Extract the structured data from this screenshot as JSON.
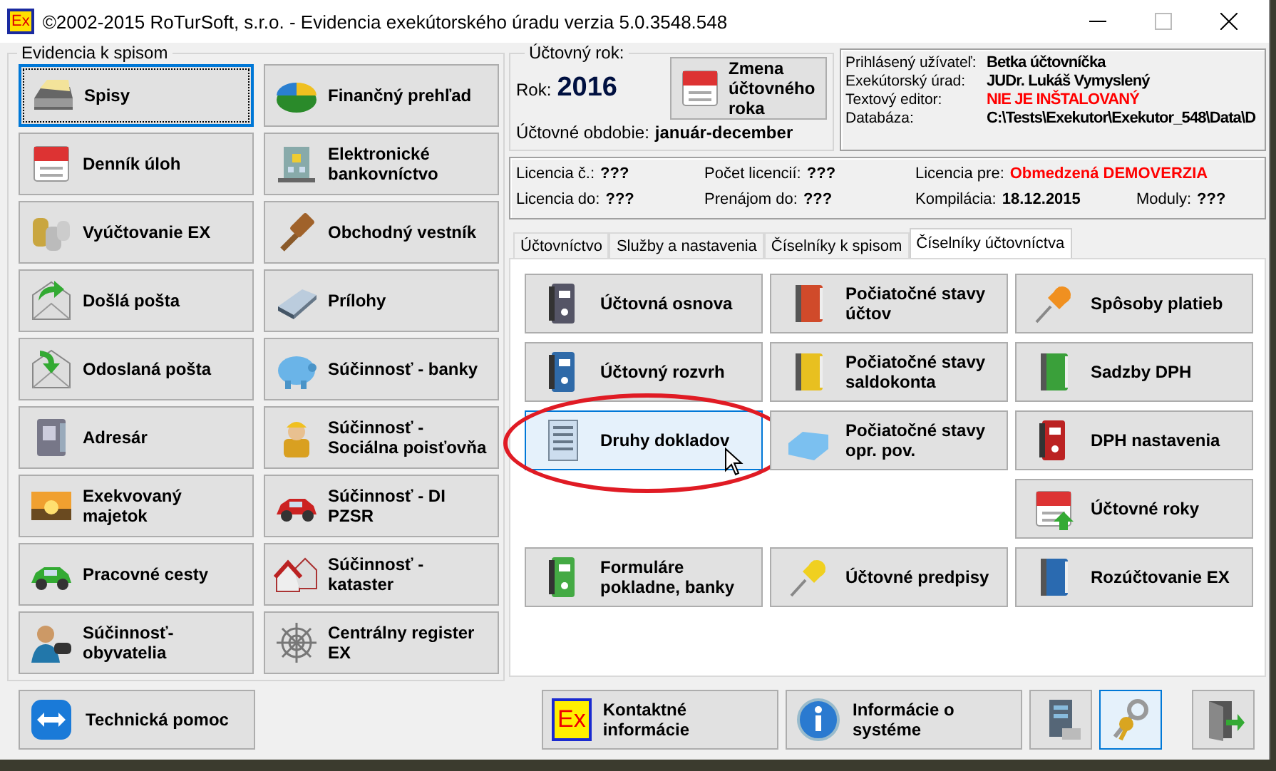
{
  "window": {
    "icon_text": "Ex",
    "title": "©2002-2015 RoTurSoft, s.r.o. - Evidencia exekútorského úradu verzia 5.0.3548.548"
  },
  "records_group": {
    "title": "Evidencia k spisom",
    "buttons": [
      {
        "label": "Spisy",
        "focused": true
      },
      {
        "label": "Finančný prehľad",
        "focused": false
      },
      {
        "label": "Denník úloh",
        "focused": false
      },
      {
        "label": "Elektronické bankovníctvo",
        "focused": false
      },
      {
        "label": "Vyúčtovanie EX",
        "focused": false
      },
      {
        "label": "Obchodný vestník",
        "focused": false
      },
      {
        "label": "Došlá pošta",
        "focused": false
      },
      {
        "label": "Prílohy",
        "focused": false
      },
      {
        "label": "Odoslaná pošta",
        "focused": false
      },
      {
        "label": "Súčinnosť - banky",
        "focused": false
      },
      {
        "label": "Adresár",
        "focused": false
      },
      {
        "label": "Súčinnosť - Sociálna poisťovňa",
        "focused": false
      },
      {
        "label": "Exekvovaný majetok",
        "focused": false
      },
      {
        "label": "Súčinnosť - DI PZSR",
        "focused": false
      },
      {
        "label": "Pracovné cesty",
        "focused": false
      },
      {
        "label": "Súčinnosť - kataster",
        "focused": false
      },
      {
        "label": "Súčinnosť- obyvatelia",
        "focused": false
      },
      {
        "label": "Centrálny register EX",
        "focused": false
      }
    ]
  },
  "year_group": {
    "title": "Účtovný rok:",
    "year_label": "Rok:",
    "year": "2016",
    "change_button": "Zmena účtovného roka",
    "period_label": "Účtovné obdobie:",
    "period": "január-december"
  },
  "info": [
    {
      "label": "Prihlásený užívateľ:",
      "value": "Betka účtovníčka",
      "alert": false
    },
    {
      "label": "Exekútorský úrad:",
      "value": "JUDr. Lukáš Vymyslený",
      "alert": false
    },
    {
      "label": "Textový editor:",
      "value": "NIE JE INŠTALOVANÝ",
      "alert": true
    },
    {
      "label": "Databáza:",
      "value": "C:\\Tests\\Exekutor\\Exekutor_548\\Data\\D",
      "alert": false
    }
  ],
  "license": [
    [
      {
        "label": "Licencia č.:",
        "value": "???",
        "alert": false
      },
      {
        "label": "Počet licencií:",
        "value": "???",
        "alert": false
      },
      {
        "label": "Licencia pre:",
        "value": "Obmedzená DEMOVERZIA",
        "alert": true
      }
    ],
    [
      {
        "label": "Licencia do:",
        "value": "???",
        "alert": false
      },
      {
        "label": "Prenájom do:",
        "value": "???",
        "alert": false
      },
      {
        "label": "Kompilácia:",
        "value": "18.12.2015",
        "alert": false
      },
      {
        "label": "Moduly:",
        "value": "???",
        "alert": false
      }
    ]
  ],
  "tabs": [
    {
      "label": "Účtovníctvo",
      "selected": false
    },
    {
      "label": "Služby a nastavenia",
      "selected": false
    },
    {
      "label": "Číselníky k spisom",
      "selected": false
    },
    {
      "label": "Číselníky účtovníctva",
      "selected": true
    }
  ],
  "tab_buttons": [
    {
      "label": "Účtovná osnova",
      "hovered": false,
      "highlighted": false
    },
    {
      "label": "Počiatočné stavy účtov",
      "hovered": false,
      "highlighted": false
    },
    {
      "label": "Spôsoby platieb",
      "hovered": false,
      "highlighted": false
    },
    {
      "label": "Účtovný rozvrh",
      "hovered": false,
      "highlighted": false
    },
    {
      "label": "Počiatočné stavy saldokonta",
      "hovered": false,
      "highlighted": false
    },
    {
      "label": "Sadzby DPH",
      "hovered": false,
      "highlighted": false
    },
    {
      "label": "Druhy dokladov",
      "hovered": true,
      "highlighted": true
    },
    {
      "label": "Počiatočné stavy opr. pov.",
      "hovered": false,
      "highlighted": false
    },
    {
      "label": "DPH nastavenia",
      "hovered": false,
      "highlighted": false
    },
    {
      "label": "Účtovné roky",
      "hovered": false,
      "highlighted": false
    },
    {
      "label": "Formuláre pokladne, banky",
      "hovered": false,
      "highlighted": false
    },
    {
      "label": "Účtovné predpisy",
      "hovered": false,
      "highlighted": false
    },
    {
      "label": "Rozúčtovanie EX",
      "hovered": false,
      "highlighted": false
    }
  ],
  "bottom_bar": {
    "help_button": "Technická pomoc",
    "contact_button": "Kontaktné informácie",
    "contact_logo_text": "Ex",
    "system_button": "Informácie o systéme",
    "icon_buttons": [
      {
        "selected": false
      },
      {
        "selected": true
      },
      {
        "selected": false
      }
    ]
  }
}
